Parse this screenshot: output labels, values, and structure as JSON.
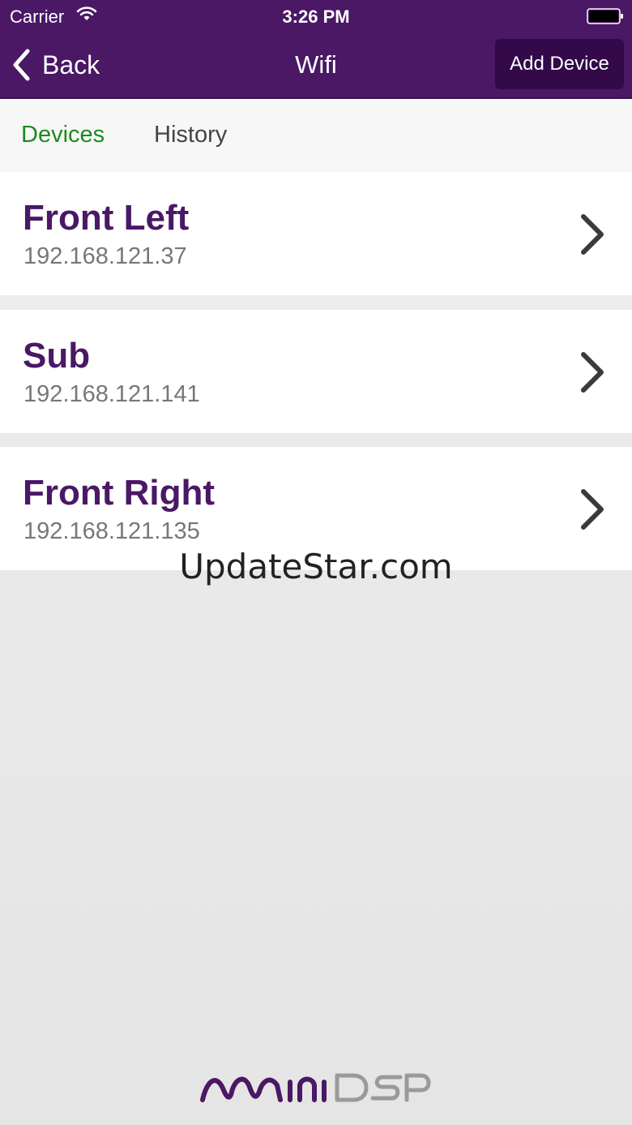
{
  "status_bar": {
    "carrier": "Carrier",
    "time": "3:26 PM",
    "icons": [
      "wifi-icon",
      "battery-icon"
    ]
  },
  "nav": {
    "back_label": "Back",
    "title": "Wifi",
    "add_device_label": "Add Device"
  },
  "tabs": [
    {
      "label": "Devices",
      "selected": true
    },
    {
      "label": "History",
      "selected": false
    }
  ],
  "devices": [
    {
      "name": "Front Left",
      "ip": "192.168.121.37"
    },
    {
      "name": "Sub",
      "ip": "192.168.121.141"
    },
    {
      "name": "Front Right",
      "ip": "192.168.121.135"
    }
  ],
  "watermark": "UpdateStar.com",
  "logo": {
    "text": "miniDSP",
    "icon": "minidsp-logo"
  },
  "colors": {
    "brand_purple": "#4a1865",
    "button_dark": "#33094a",
    "tab_active": "#1e8a1e",
    "tab_inactive": "#444444",
    "ip_gray": "#777777"
  }
}
